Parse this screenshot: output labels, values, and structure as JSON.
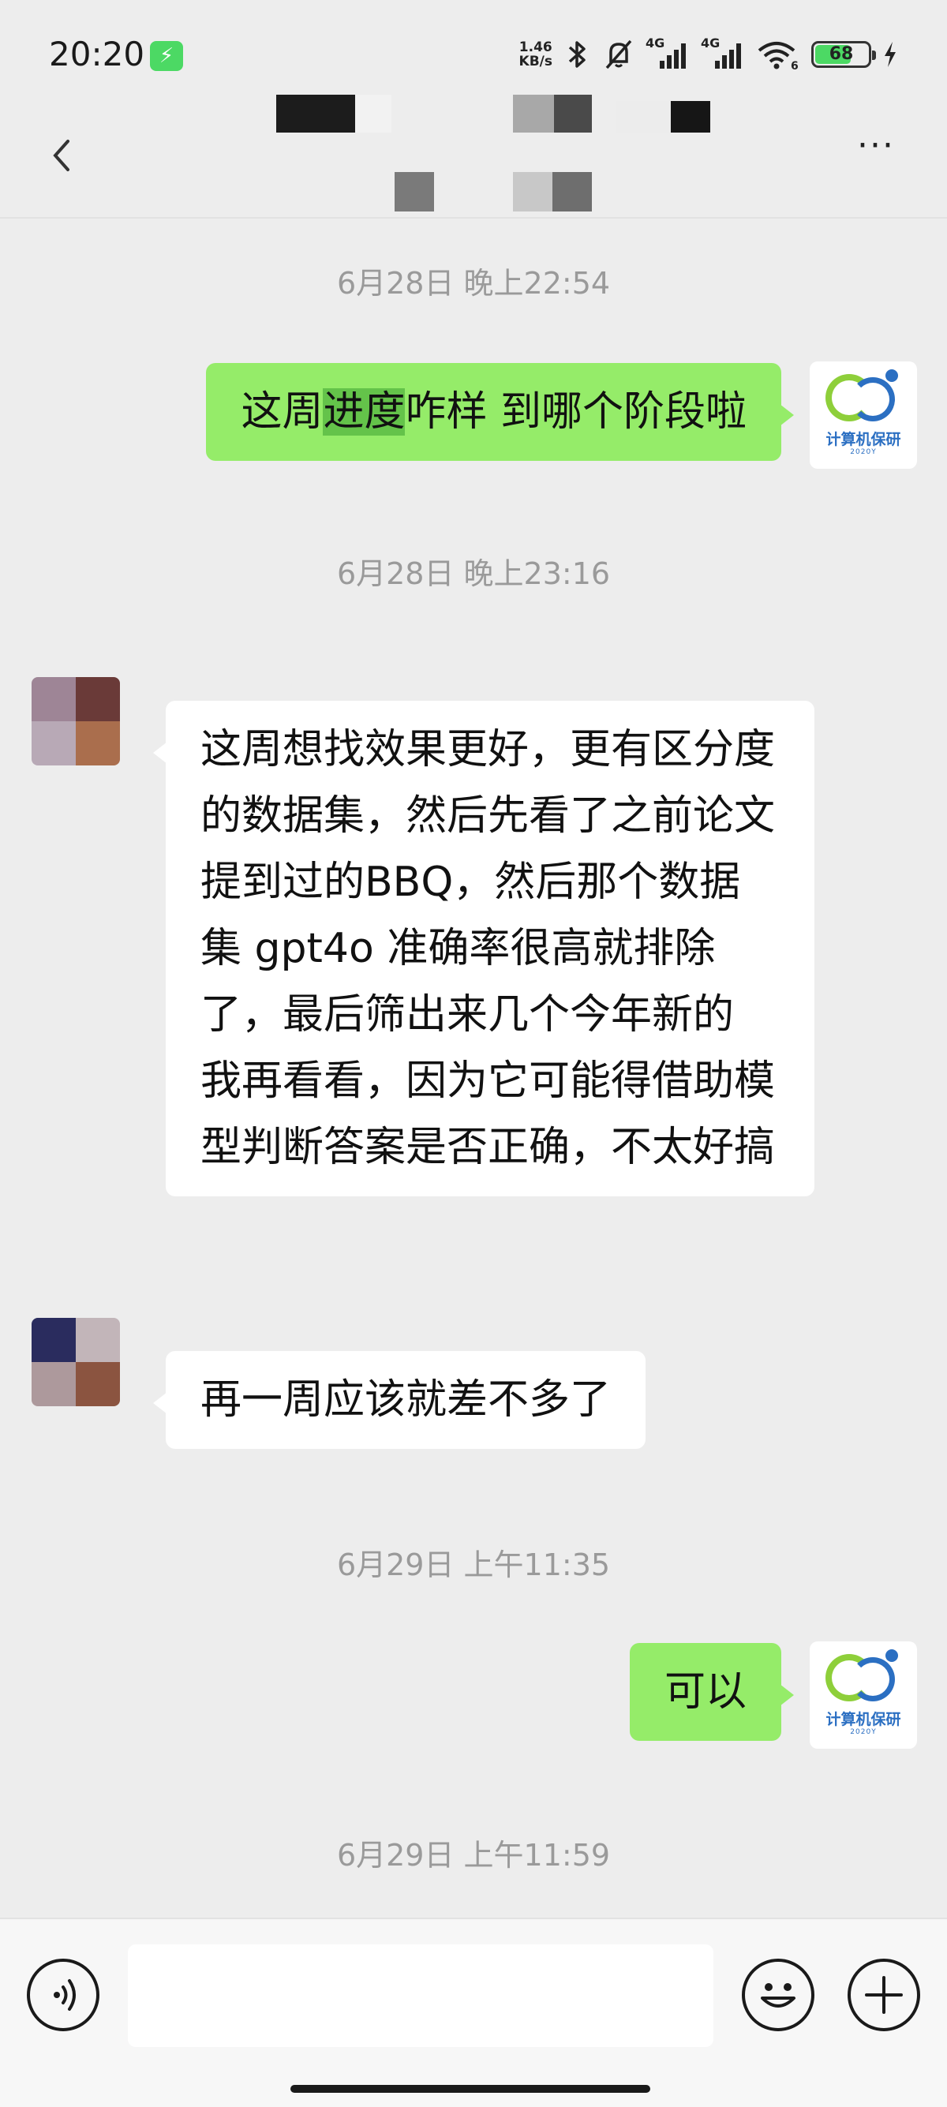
{
  "status_bar": {
    "time": "20:20",
    "charging_icon": "bolt-icon",
    "net_speed_value": "1.46",
    "net_speed_unit": "KB/s",
    "signal_label_1": "4G",
    "signal_label_2": "4G",
    "wifi_label": "6",
    "battery": "68"
  },
  "header": {
    "back_icon": "chevron-left-icon",
    "more_label": "···"
  },
  "messages": {
    "ts1": "6月28日 晚上22:54",
    "m1_part1": "这周",
    "m1_highlight": "进度",
    "m1_part2": "咋样 到哪个阶段啦",
    "ts2": "6月28日 晚上23:16",
    "m2": "这周想找效果更好，更有区分度的数据集，然后先看了之前论文提到过的BBQ，然后那个数据集 gpt4o 准确率很高就排除了，最后筛出来几个今年新的 我再看看，因为它可能得借助模型判断答案是否正确，不太好搞",
    "m3": "再一周应该就差不多了",
    "ts3": "6月29日 上午11:35",
    "m4": "可以",
    "ts4": "6月29日 上午11:59"
  },
  "self_avatar": {
    "logo_text": "计算机保研",
    "logo_sub": "2020Y"
  },
  "colors": {
    "sent_bubble": "#95ec69",
    "received_bubble": "#ffffff",
    "highlight": "#64c34a",
    "background": "#ededed"
  }
}
